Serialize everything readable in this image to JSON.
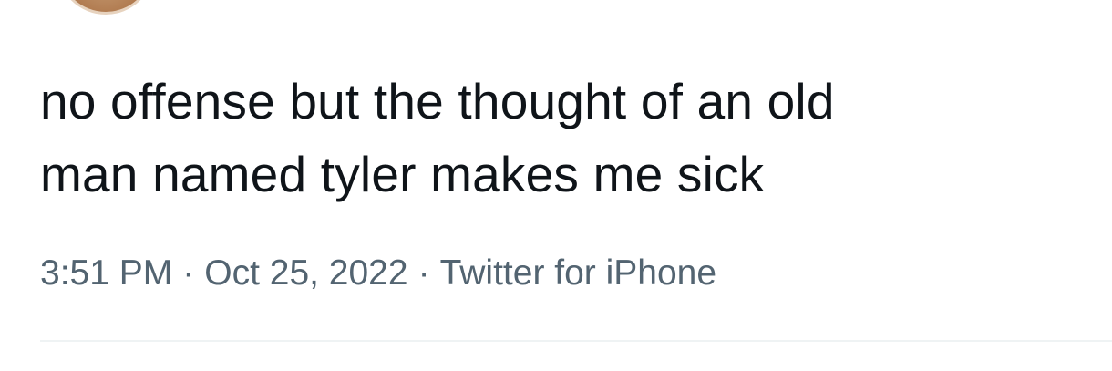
{
  "tweet": {
    "text_lines": [
      "no offense but the thought of an old",
      "man named tyler makes me sick"
    ]
  },
  "meta": {
    "time": "3:51 PM",
    "separator": "·",
    "date": "Oct 25, 2022",
    "source": "Twitter for iPhone"
  },
  "colors": {
    "text": "#0f1419",
    "secondary": "#536471",
    "divider": "#eff3f4"
  }
}
